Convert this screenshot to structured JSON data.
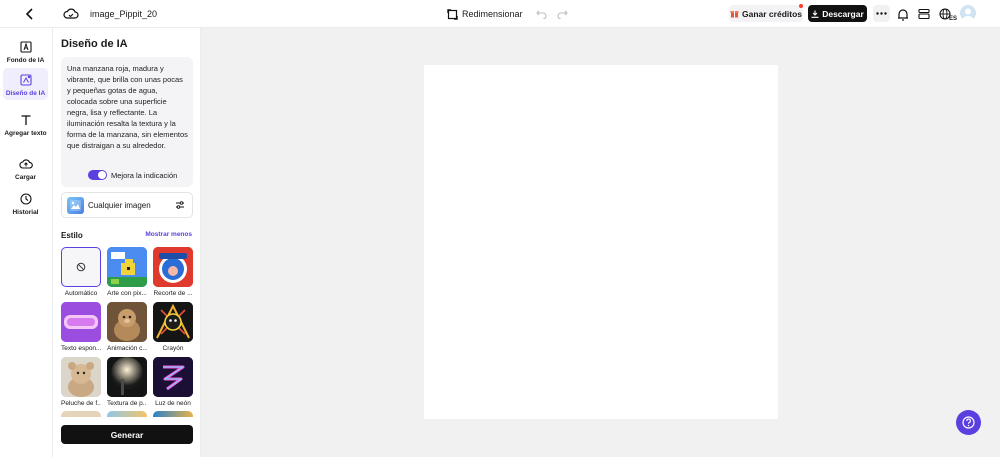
{
  "header": {
    "filename": "image_Pippit_20",
    "resize_label": "Redimensionar",
    "earn_label": "Ganar créditos",
    "download_label": "Descargar",
    "language_code": "ES"
  },
  "nav": {
    "items": [
      {
        "label": "Fondo de IA"
      },
      {
        "label": "Diseño de IA"
      },
      {
        "label": "Agregar texto"
      },
      {
        "label": "Cargar"
      },
      {
        "label": "Historial"
      }
    ]
  },
  "panel": {
    "title": "Diseño de IA",
    "prompt": "Una manzana roja, madura y vibrante, que brilla con unas pocas y pequeñas gotas de agua, colocada sobre una superficie negra, lisa y reflectante. La iluminación resalta la textura y la forma de la manzana, sin elementos que distraigan a su alrededor.",
    "enhance_label": "Mejora la indicación",
    "image_type_label": "Cualquier imagen",
    "style_label": "Estilo",
    "show_less_label": "Mostrar menos",
    "styles": [
      {
        "label": "Automático"
      },
      {
        "label": "Arte con pix..."
      },
      {
        "label": "Recorte de ..."
      },
      {
        "label": "Texto espon..."
      },
      {
        "label": "Animación c..."
      },
      {
        "label": "Crayón"
      },
      {
        "label": "Peluche de f..."
      },
      {
        "label": "Textura de p..."
      },
      {
        "label": "Luz de neón"
      }
    ],
    "generate_label": "Generar"
  },
  "colors": {
    "accent": "#5b3fe0",
    "dark_button": "#111111",
    "workspace_bg": "#f1f1f1"
  }
}
